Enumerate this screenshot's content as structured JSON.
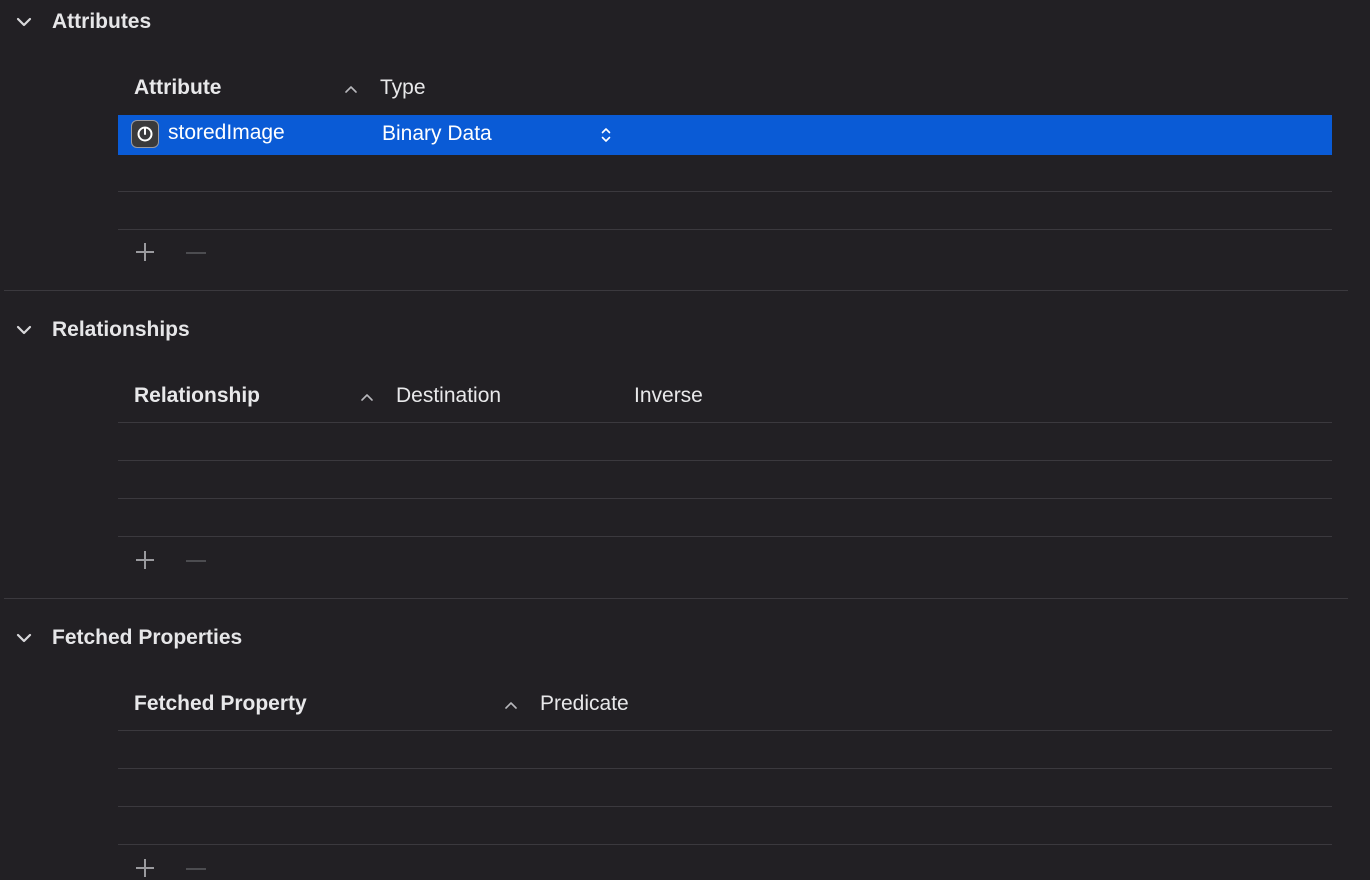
{
  "attributes": {
    "title": "Attributes",
    "columns": {
      "attribute": "Attribute",
      "type": "Type"
    },
    "rows": [
      {
        "name": "storedImage",
        "type": "Binary Data",
        "selected": true
      }
    ]
  },
  "relationships": {
    "title": "Relationships",
    "columns": {
      "relationship": "Relationship",
      "destination": "Destination",
      "inverse": "Inverse"
    }
  },
  "fetched_properties": {
    "title": "Fetched Properties",
    "columns": {
      "fetched_property": "Fetched Property",
      "predicate": "Predicate"
    }
  },
  "colors": {
    "background": "#222024",
    "selection": "#0a5bd6",
    "separator": "#3b393e",
    "text": "#e8e8ea"
  },
  "icons": {
    "disclosure": "chevron-down-icon",
    "sort": "chevron-up-icon",
    "row_type": "attribute-type-icon",
    "stepper": "up-down-stepper-icon",
    "add": "plus-icon",
    "remove": "minus-icon"
  }
}
